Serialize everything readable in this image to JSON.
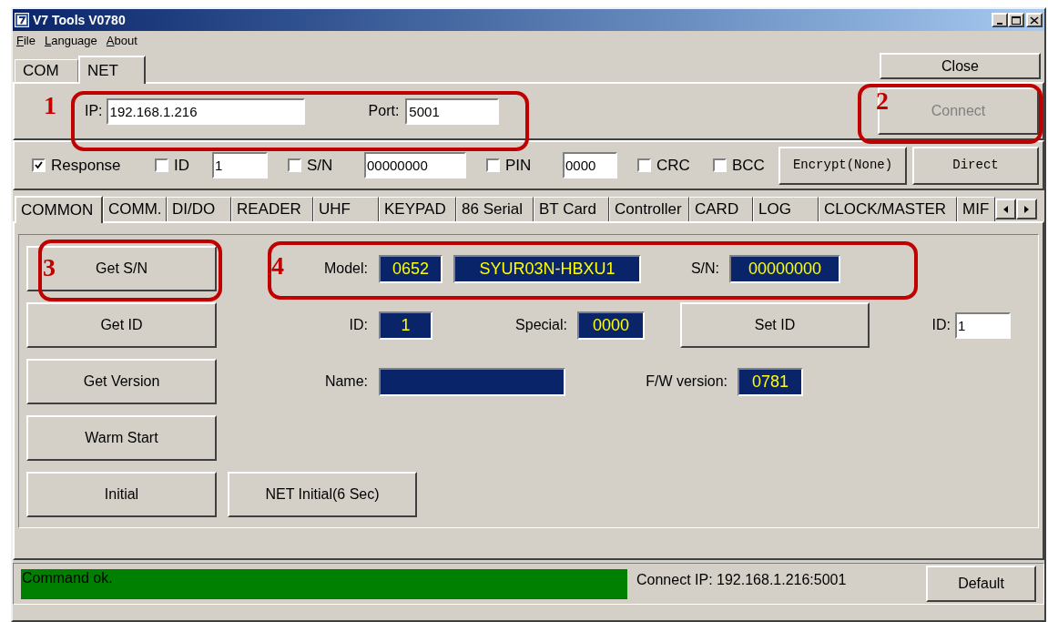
{
  "window": {
    "title": "V7 Tools V0780"
  },
  "menu": [
    "File",
    "Language",
    "About"
  ],
  "connection_tabs": [
    {
      "label": "COM",
      "selected": false
    },
    {
      "label": "NET",
      "selected": true
    }
  ],
  "close_button": "Close",
  "net": {
    "ip_label": "IP:",
    "ip": "192.168.1.216",
    "port_label": "Port:",
    "port": "5001"
  },
  "connect_button": {
    "label": "Connect",
    "disabled": true
  },
  "options": [
    {
      "kind": "checkbox",
      "label": "Response",
      "checked": true
    },
    {
      "kind": "checkbox",
      "label": "ID",
      "checked": false
    },
    {
      "kind": "field",
      "value": "1"
    },
    {
      "kind": "checkbox",
      "label": "S/N",
      "checked": false
    },
    {
      "kind": "field",
      "value": "00000000"
    },
    {
      "kind": "checkbox",
      "label": "PIN",
      "checked": false
    },
    {
      "kind": "field",
      "value": "0000"
    },
    {
      "kind": "checkbox",
      "label": "CRC",
      "checked": false
    },
    {
      "kind": "checkbox",
      "label": "BCC",
      "checked": false
    }
  ],
  "option_buttons": [
    "Encrypt(None)",
    "Direct"
  ],
  "function_tabs": [
    {
      "label": "COMMON",
      "selected": true
    },
    {
      "label": "COMM.",
      "selected": false
    },
    {
      "label": "DI/DO",
      "selected": false
    },
    {
      "label": "READER",
      "selected": false
    },
    {
      "label": "UHF",
      "selected": false
    },
    {
      "label": "KEYPAD",
      "selected": false
    },
    {
      "label": "86 Serial",
      "selected": false
    },
    {
      "label": "BT Card",
      "selected": false
    },
    {
      "label": "Controller",
      "selected": false
    },
    {
      "label": "CARD",
      "selected": false
    },
    {
      "label": "LOG",
      "selected": false
    },
    {
      "label": "CLOCK/MASTER",
      "selected": false
    },
    {
      "label": "MIF",
      "selected": false
    }
  ],
  "common": {
    "buttons": [
      "Get S/N",
      "Get ID",
      "Get Version",
      "Warm Start",
      "Initial"
    ],
    "net_initial_button": "NET Initial(6 Sec)",
    "model_label": "Model:",
    "model_code": "0652",
    "model_name": "SYUR03N-HBXU1",
    "sn_label": "S/N:",
    "sn": "00000000",
    "id_label": "ID:",
    "id": "1",
    "special_label": "Special:",
    "special": "0000",
    "set_id_button": "Set ID",
    "set_id_label": "ID:",
    "set_id_value": "1",
    "name_label": "Name:",
    "fw_label": "F/W version:",
    "fw": "0781"
  },
  "status_bar": {
    "message": "Command ok.",
    "connect_ip": "Connect IP: 192.168.1.216:5001",
    "default_button": "Default"
  },
  "annotations": [
    {
      "number": "1"
    },
    {
      "number": "2"
    },
    {
      "number": "3"
    },
    {
      "number": "4"
    }
  ]
}
